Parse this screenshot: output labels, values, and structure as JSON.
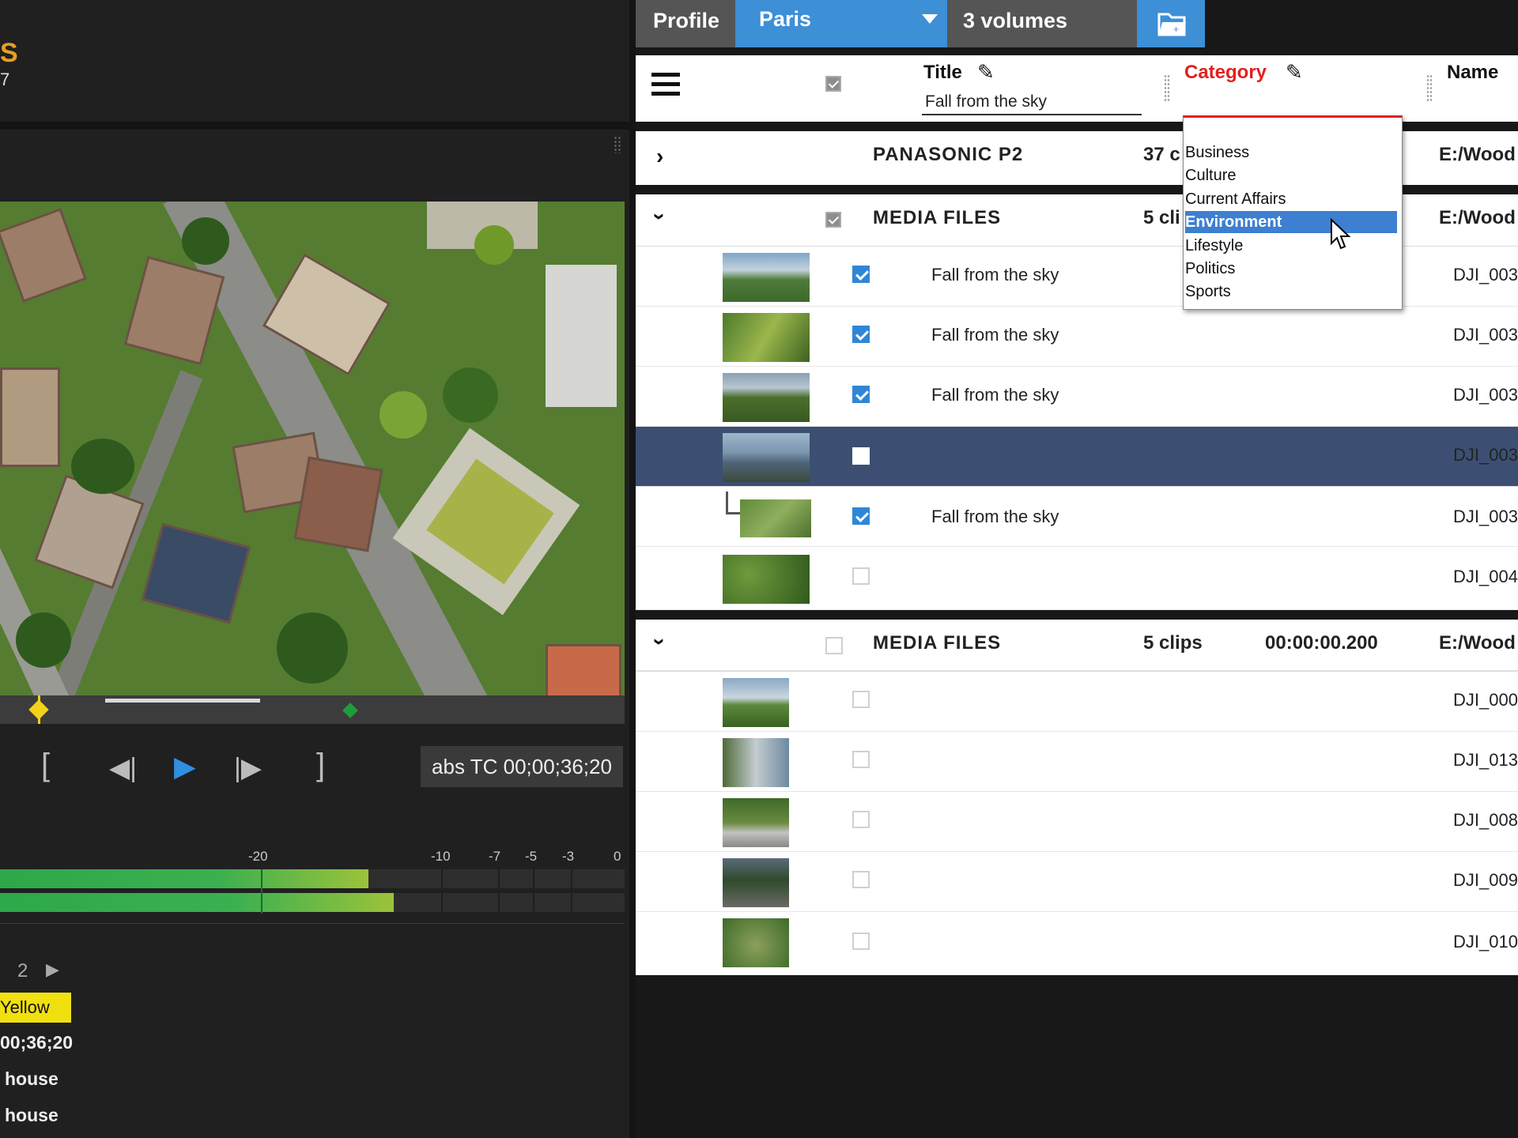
{
  "logo": {
    "line1": "S",
    "line2": "7"
  },
  "player": {
    "timecode": "abs TC 00;00;36;20",
    "transport": {
      "mark_in": "[",
      "prev_frame": "◀|",
      "play": "▶",
      "next_frame": "|▶",
      "mark_out": "]"
    },
    "meter_ticks": [
      "-20",
      "-10",
      "-7",
      "-5",
      "-3",
      "0"
    ],
    "meter_levels": [
      0.59,
      0.63
    ],
    "scrub_progress": 0.13
  },
  "markers": {
    "page": "2",
    "next": "▶",
    "color_label": "Yellow",
    "timecode": "00;36;20",
    "lines": [
      "house",
      "house"
    ]
  },
  "breadcrumb": {
    "profile": "Profile",
    "location": "Paris",
    "volumes": "3 volumes",
    "folder_icon": "folder-open-icon"
  },
  "columns": {
    "title": "Title",
    "title_filter": "Fall from the sky",
    "category": "Category",
    "name": "Name"
  },
  "category_dropdown": {
    "options": [
      "Business",
      "Culture",
      "Current Affairs",
      "Environment",
      "Lifestyle",
      "Politics",
      "Sports"
    ],
    "highlighted": "Environment"
  },
  "groups": [
    {
      "title": "PANASONIC P2",
      "count": "37 c",
      "path": "E:/Wood"
    },
    {
      "title": "MEDIA FILES",
      "count": "5 cli",
      "path": "E:/Wood",
      "rows": [
        {
          "title": "Fall from the sky",
          "name": "DJI_003",
          "checked": true
        },
        {
          "title": "Fall from the sky",
          "name": "DJI_003",
          "checked": true
        },
        {
          "title": "Fall from the sky",
          "name": "DJI_003",
          "checked": true
        },
        {
          "title": "",
          "name": "DJI_003",
          "checked": false,
          "selected": true
        },
        {
          "title": "Fall from the sky",
          "name": "DJI_003",
          "checked": true
        },
        {
          "title": "",
          "name": "DJI_004",
          "checked": false
        }
      ]
    },
    {
      "title": "MEDIA FILES",
      "count": "5 clips",
      "duration": "00:00:00.200",
      "path": "E:/Wood",
      "rows": [
        {
          "name": "DJI_000"
        },
        {
          "name": "DJI_013"
        },
        {
          "name": "DJI_008"
        },
        {
          "name": "DJI_009"
        },
        {
          "name": "DJI_010"
        }
      ]
    }
  ]
}
